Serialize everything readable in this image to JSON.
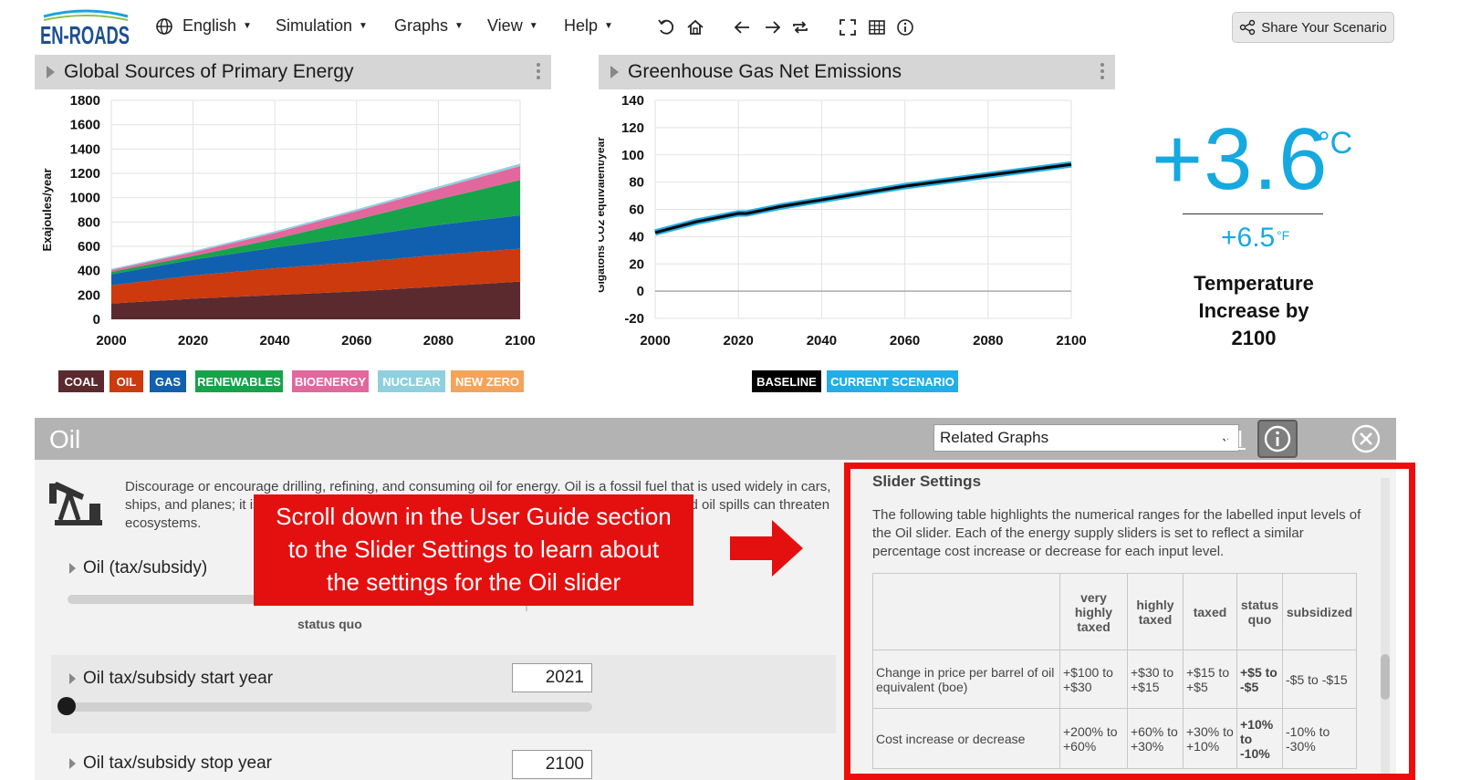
{
  "topbar": {
    "logo_text": "EN-ROADS",
    "language": "English",
    "menus": [
      "Simulation",
      "Graphs",
      "View",
      "Help"
    ],
    "share_label": "Share Your Scenario"
  },
  "graph_left": {
    "title": "Global Sources of Primary Energy",
    "ylabel": "Exajoules/year",
    "yticks": [
      "1800",
      "1600",
      "1400",
      "1200",
      "1000",
      "800",
      "600",
      "400",
      "200",
      "0"
    ],
    "xticks": [
      "2000",
      "2020",
      "2040",
      "2060",
      "2080",
      "2100"
    ],
    "legend": [
      {
        "label": "COAL",
        "color": "#5b2a2f"
      },
      {
        "label": "OIL",
        "color": "#cc3a0e"
      },
      {
        "label": "GAS",
        "color": "#1160b0"
      },
      {
        "label": "RENEWABLES",
        "color": "#16a34a"
      },
      {
        "label": "BIOENERGY",
        "color": "#e2679d"
      },
      {
        "label": "NUCLEAR",
        "color": "#8fd0df"
      },
      {
        "label": "NEW ZERO",
        "color": "#f3a45a"
      }
    ]
  },
  "graph_right": {
    "title": "Greenhouse Gas Net Emissions",
    "ylabel": "Gigatons CO2 equivalent/year",
    "yticks": [
      "140",
      "120",
      "100",
      "80",
      "60",
      "40",
      "20",
      "0",
      "-20"
    ],
    "xticks": [
      "2000",
      "2020",
      "2040",
      "2060",
      "2080",
      "2100"
    ],
    "legend": [
      {
        "label": "BASELINE",
        "color": "#000000"
      },
      {
        "label": "CURRENT SCENARIO",
        "color": "#22aee6"
      }
    ]
  },
  "chart_data": [
    {
      "type": "area",
      "title": "Global Sources of Primary Energy",
      "xlabel": "",
      "ylabel": "Exajoules/year",
      "xlim": [
        2000,
        2100
      ],
      "ylim": [
        0,
        1800
      ],
      "x": [
        2000,
        2020,
        2040,
        2060,
        2080,
        2100
      ],
      "stacked": true,
      "series": [
        {
          "name": "COAL",
          "color": "#5b2a2f",
          "values": [
            130,
            170,
            200,
            230,
            270,
            310
          ]
        },
        {
          "name": "OIL",
          "color": "#cc3a0e",
          "values": [
            150,
            190,
            220,
            240,
            260,
            270
          ]
        },
        {
          "name": "GAS",
          "color": "#1160b0",
          "values": [
            90,
            130,
            170,
            210,
            245,
            275
          ]
        },
        {
          "name": "RENEWABLES",
          "color": "#16a34a",
          "values": [
            20,
            30,
            70,
            140,
            210,
            290
          ]
        },
        {
          "name": "BIOENERGY",
          "color": "#e2679d",
          "values": [
            15,
            30,
            50,
            70,
            90,
            115
          ]
        },
        {
          "name": "NUCLEAR",
          "color": "#8fd0df",
          "values": [
            10,
            12,
            14,
            15,
            17,
            20
          ]
        },
        {
          "name": "NEW ZERO",
          "color": "#f3a45a",
          "values": [
            0,
            0,
            0,
            0,
            0,
            0
          ]
        }
      ]
    },
    {
      "type": "line",
      "title": "Greenhouse Gas Net Emissions",
      "xlabel": "",
      "ylabel": "Gigatons CO2 equivalent/year",
      "xlim": [
        2000,
        2100
      ],
      "ylim": [
        -20,
        140
      ],
      "x": [
        2000,
        2010,
        2020,
        2022,
        2030,
        2040,
        2050,
        2060,
        2070,
        2080,
        2090,
        2100
      ],
      "series": [
        {
          "name": "BASELINE",
          "color": "#000000",
          "values": [
            43,
            51,
            57,
            57,
            62,
            67,
            72,
            77,
            81,
            85,
            89,
            93
          ]
        },
        {
          "name": "CURRENT SCENARIO",
          "color": "#22aee6",
          "values": [
            43,
            51,
            57,
            57,
            62,
            67,
            72,
            77,
            81,
            85,
            89,
            93
          ]
        }
      ]
    }
  ],
  "temperature": {
    "celsius": "+3.6",
    "celsius_unit": "°C",
    "fahrenheit": "+6.5",
    "fahrenheit_unit": "°F",
    "caption_1": "Temperature",
    "caption_2": "Increase by",
    "caption_3": "2100"
  },
  "oil_panel": {
    "title": "Oil",
    "related_graphs": "Related Graphs",
    "description": "Discourage or encourage drilling, refining, and consuming oil for energy. Oil is a fossil fuel that is used widely in cars, ships, and planes; it is a major source of carbon emissions and has caused major conflicts and oil spills can threaten ecosystems.",
    "slider_main": {
      "label": "Oil (tax/subsidy)",
      "status": "status quo",
      "level_fraction": 0.53
    },
    "slider_start": {
      "label": "Oil tax/subsidy start year",
      "value": "2021"
    },
    "slider_stop": {
      "label": "Oil tax/subsidy stop year",
      "value": "2100"
    }
  },
  "guide": {
    "heading": "Slider Settings",
    "text": "The following table highlights the numerical ranges for the labelled input levels of the Oil slider. Each of the energy supply sliders is set to reflect a similar percentage cost increase or decrease for each input level.",
    "columns": [
      "very highly taxed",
      "highly taxed",
      "taxed",
      "status quo",
      "subsidized"
    ],
    "rows": [
      {
        "label": "Change in price per barrel of oil equivalent (boe)",
        "cells": [
          "+$100 to +$30",
          "+$30 to +$15",
          "+$15 to +$5",
          "+$5 to -$5",
          "-$5 to -$15"
        ]
      },
      {
        "label": "Cost increase or decrease",
        "cells": [
          "+200% to +60%",
          "+60% to +30%",
          "+30% to +10%",
          "+10% to -10%",
          "-10% to -30%"
        ]
      }
    ]
  },
  "callout": {
    "line1": "Scroll down in the User Guide section",
    "line2": "to the Slider Settings to learn about",
    "line3": "the settings for the Oil slider"
  }
}
